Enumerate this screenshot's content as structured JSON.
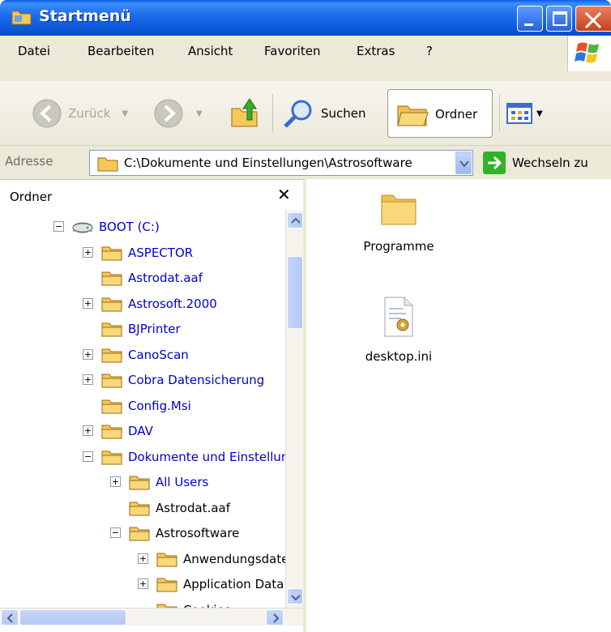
{
  "window": {
    "title": "Startmenü",
    "colors": {
      "titlebar": "#0c57d8",
      "close_button": "#c4421c",
      "chrome": "#ece9d8"
    }
  },
  "menu": {
    "items": [
      {
        "label": "Datei"
      },
      {
        "label": "Bearbeiten"
      },
      {
        "label": "Ansicht"
      },
      {
        "label": "Favoriten"
      },
      {
        "label": "Extras"
      },
      {
        "label": "?"
      }
    ]
  },
  "toolbar": {
    "back_label": "Zurück",
    "search_label": "Suchen",
    "folders_label": "Ordner"
  },
  "address": {
    "label": "Adresse",
    "value": "C:\\Dokumente und Einstellungen\\Astrosoftware",
    "go_label": "Wechseln zu"
  },
  "folder_pane": {
    "title": "Ordner",
    "tree": [
      {
        "label": "BOOT (C:)",
        "expander": "minus",
        "icon": "drive-icon",
        "color": "blue"
      },
      {
        "label": "ASPECTOR",
        "expander": "plus",
        "icon": "folder-icon",
        "color": "blue"
      },
      {
        "label": "Astrodat.aaf",
        "expander": "",
        "icon": "folder-icon",
        "color": "blue"
      },
      {
        "label": "Astrosoft.2000",
        "expander": "plus",
        "icon": "folder-icon",
        "color": "blue"
      },
      {
        "label": "BJPrinter",
        "expander": "",
        "icon": "folder-icon",
        "color": "blue"
      },
      {
        "label": "CanoScan",
        "expander": "plus",
        "icon": "folder-icon",
        "color": "blue"
      },
      {
        "label": "Cobra Datensicherung",
        "expander": "plus",
        "icon": "folder-icon",
        "color": "blue"
      },
      {
        "label": "Config.Msi",
        "expander": "",
        "icon": "folder-icon",
        "color": "blue"
      },
      {
        "label": "DAV",
        "expander": "plus",
        "icon": "folder-icon",
        "color": "blue"
      },
      {
        "label": "Dokumente und Einstellungen",
        "expander": "minus",
        "icon": "folder-icon",
        "color": "blue"
      },
      {
        "label": "All Users",
        "expander": "plus",
        "icon": "folder-icon",
        "color": "blue"
      },
      {
        "label": "Astrodat.aaf",
        "expander": "",
        "icon": "folder-icon",
        "color": "black"
      },
      {
        "label": "Astrosoftware",
        "expander": "minus",
        "icon": "folder-icon",
        "color": "black"
      },
      {
        "label": "Anwendungsdaten",
        "expander": "plus",
        "icon": "folder-icon",
        "color": "black"
      },
      {
        "label": "Application Data",
        "expander": "plus",
        "icon": "folder-icon",
        "color": "black"
      },
      {
        "label": "Cookies",
        "expander": "",
        "icon": "folder-icon",
        "color": "black"
      }
    ]
  },
  "content": {
    "items": [
      {
        "label": "Programme",
        "icon": "folder-icon"
      },
      {
        "label": "desktop.ini",
        "icon": "ini-file-icon"
      }
    ]
  }
}
